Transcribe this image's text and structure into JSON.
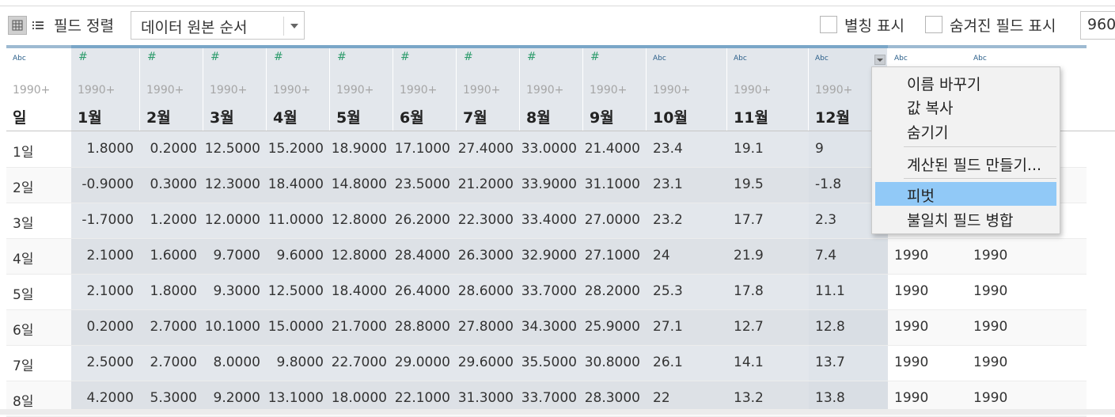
{
  "toolbar": {
    "sort_label": "필드 정렬",
    "sort_value": "데이터 원본 순서",
    "alias_label": "별칭 표시",
    "hidden_label": "숨겨진 필드 표시",
    "rows_value": "960"
  },
  "columns": [
    {
      "type": "Abc",
      "source": "1990+",
      "name": "일"
    },
    {
      "type": "#",
      "source": "1990+",
      "name": "1월"
    },
    {
      "type": "#",
      "source": "1990+",
      "name": "2월"
    },
    {
      "type": "#",
      "source": "1990+",
      "name": "3월"
    },
    {
      "type": "#",
      "source": "1990+",
      "name": "4월"
    },
    {
      "type": "#",
      "source": "1990+",
      "name": "5월"
    },
    {
      "type": "#",
      "source": "1990+",
      "name": "6월"
    },
    {
      "type": "#",
      "source": "1990+",
      "name": "7월"
    },
    {
      "type": "#",
      "source": "1990+",
      "name": "8월"
    },
    {
      "type": "#",
      "source": "1990+",
      "name": "9월"
    },
    {
      "type": "Abc",
      "source": "1990+",
      "name": "10월"
    },
    {
      "type": "Abc",
      "source": "1990+",
      "name": "11월"
    },
    {
      "type": "Abc",
      "source": "1990+",
      "name": "12월"
    },
    {
      "type": "Abc",
      "source": "",
      "name": ""
    },
    {
      "type": "Abc",
      "source": "",
      "name": ""
    }
  ],
  "rows": [
    [
      "1일",
      "1.8000",
      "0.2000",
      "12.5000",
      "15.2000",
      "18.9000",
      "17.1000",
      "27.4000",
      "33.0000",
      "21.4000",
      "23.4",
      "19.1",
      "9",
      "",
      ""
    ],
    [
      "2일",
      "-0.9000",
      "0.3000",
      "12.3000",
      "18.4000",
      "14.8000",
      "23.5000",
      "21.2000",
      "33.9000",
      "31.1000",
      "23.1",
      "19.5",
      "-1.8",
      "",
      ""
    ],
    [
      "3일",
      "-1.7000",
      "1.2000",
      "12.0000",
      "11.0000",
      "12.8000",
      "26.2000",
      "22.3000",
      "33.4000",
      "27.0000",
      "23.2",
      "17.7",
      "2.3",
      "",
      ""
    ],
    [
      "4일",
      "2.1000",
      "1.6000",
      "9.7000",
      "9.6000",
      "12.8000",
      "28.4000",
      "26.3000",
      "32.9000",
      "27.1000",
      "24",
      "21.9",
      "7.4",
      "1990",
      "1990"
    ],
    [
      "5일",
      "2.1000",
      "1.8000",
      "9.3000",
      "12.5000",
      "18.4000",
      "26.4000",
      "28.6000",
      "33.7000",
      "28.2000",
      "25.3",
      "17.8",
      "11.1",
      "1990",
      "1990"
    ],
    [
      "6일",
      "0.2000",
      "2.7000",
      "10.1000",
      "15.0000",
      "21.7000",
      "28.8000",
      "27.8000",
      "34.3000",
      "25.9000",
      "27.1",
      "12.7",
      "12.8",
      "1990",
      "1990"
    ],
    [
      "7일",
      "2.5000",
      "2.7000",
      "8.0000",
      "9.8000",
      "22.7000",
      "29.0000",
      "29.6000",
      "35.5000",
      "30.8000",
      "26.1",
      "14.1",
      "13.7",
      "1990",
      "1990"
    ],
    [
      "8일",
      "4.2000",
      "5.3000",
      "9.2000",
      "13.1000",
      "18.0000",
      "22.1000",
      "31.3000",
      "33.7000",
      "28.3000",
      "22",
      "13.2",
      "13.8",
      "1990",
      "1990"
    ]
  ],
  "context_menu": {
    "items": [
      "이름 바꾸기",
      "값 복사",
      "숨기기",
      "계산된 필드 만들기...",
      "피벗",
      "불일치 필드 병합"
    ],
    "highlighted": "피벗"
  }
}
